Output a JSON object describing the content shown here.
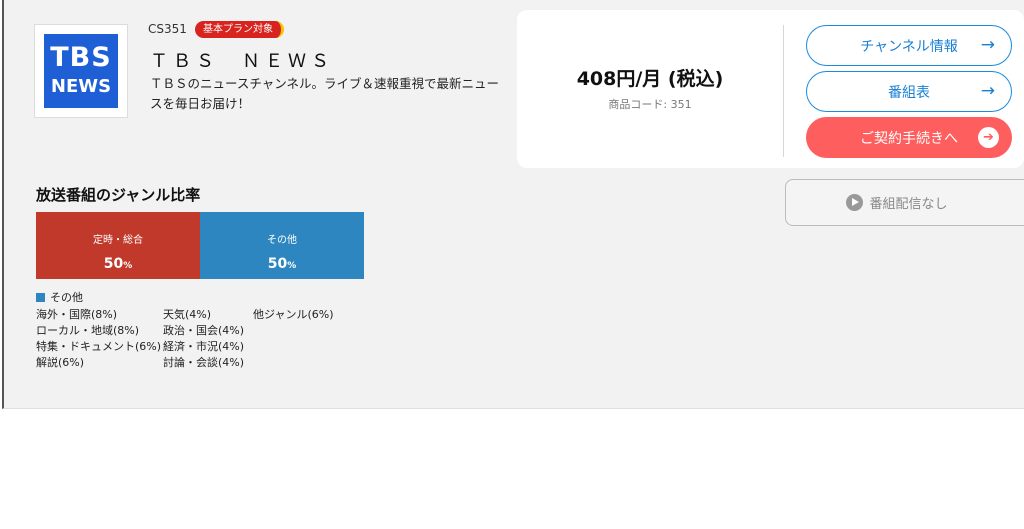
{
  "channel": {
    "logo_line1": "TBS",
    "logo_line2": "NEWS",
    "code_label": "CS351",
    "badge": "基本プラン対象",
    "name": "ＴＢＳ　ＮＥＷＳ",
    "description": "ＴＢＳのニュースチャンネル。ライブ＆速報重視で最新ニュースを毎日お届け！"
  },
  "pricing": {
    "price": "408円/月 (税込)",
    "product_code": "商品コード: 351"
  },
  "actions": {
    "channel_info": "チャンネル情報",
    "schedule": "番組表",
    "contract": "ご契約手続きへ",
    "no_distribution": "番組配信なし",
    "arrow": "→",
    "arrow_circle": "➔"
  },
  "genre": {
    "title": "放送番組のジャンル比率",
    "segments": [
      {
        "label": "定時・総合",
        "value": 50,
        "value_text": "50",
        "unit": "%",
        "color": "#c0392b"
      },
      {
        "label": "その他",
        "value": 50,
        "value_text": "50",
        "unit": "%",
        "color": "#2e86c1"
      }
    ],
    "legend_header": "その他",
    "legend_color": "#2e86c1",
    "items": [
      "海外・国際(8%)",
      "ローカル・地域(8%)",
      "特集・ドキュメント(6%)",
      "解説(6%)",
      "天気(4%)",
      "政治・国会(4%)",
      "経済・市況(4%)",
      "討論・会談(4%)",
      "他ジャンル(6%)"
    ]
  },
  "icons": {
    "arrow": "arrow-right-icon",
    "play": "play-circle-icon",
    "legend_square": "legend-square-icon"
  }
}
